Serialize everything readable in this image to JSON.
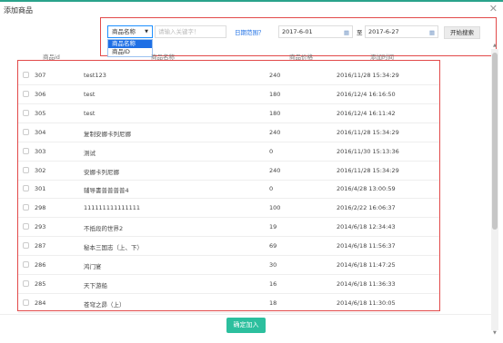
{
  "dialog": {
    "title": "添加商品",
    "confirm_label": "确定加入"
  },
  "search": {
    "type_selected": "商品名称",
    "type_options": [
      "商品名称",
      "商品ID"
    ],
    "keyword_placeholder": "请输入关键字！",
    "date_label": "日期范围？",
    "date_from": "2017-6-01",
    "to_label": "至",
    "date_to": "2017-6-27",
    "search_button": "开始搜索"
  },
  "table": {
    "headers": [
      "商品id",
      "商品名称",
      "商品价格",
      "添加时间"
    ],
    "rows": [
      {
        "id": "307",
        "name": "test123",
        "price": "240",
        "time": "2016/11/28 15:34:29"
      },
      {
        "id": "306",
        "name": "test",
        "price": "180",
        "time": "2016/12/4 16:16:50"
      },
      {
        "id": "305",
        "name": "test",
        "price": "180",
        "time": "2016/12/4 16:11:42"
      },
      {
        "id": "304",
        "name": "复制安娜卡列尼娜",
        "price": "240",
        "time": "2016/11/28 15:34:29"
      },
      {
        "id": "303",
        "name": "测试",
        "price": "0",
        "time": "2016/11/30 15:13:36"
      },
      {
        "id": "302",
        "name": "安娜卡列尼娜",
        "price": "240",
        "time": "2016/11/28 15:34:29"
      },
      {
        "id": "301",
        "name": "辅导書普普普普4",
        "price": "0",
        "time": "2016/4/28 13:00:59"
      },
      {
        "id": "298",
        "name": "111111111111111",
        "price": "100",
        "time": "2016/2/22 16:06:37"
      },
      {
        "id": "293",
        "name": "不抵段的世界2",
        "price": "19",
        "time": "2014/6/18 12:34:43"
      },
      {
        "id": "287",
        "name": "秘本三国志（上、下）",
        "price": "69",
        "time": "2014/6/18 11:56:37"
      },
      {
        "id": "286",
        "name": "鸿门宴",
        "price": "30",
        "time": "2014/6/18 11:47:25"
      },
      {
        "id": "285",
        "name": "天下游船",
        "price": "16",
        "time": "2014/6/18 11:36:33"
      },
      {
        "id": "284",
        "name": "苍穹之昴（上）",
        "price": "18",
        "time": "2014/6/18 11:30:05"
      }
    ]
  },
  "colors": {
    "accent": "#2cbf9e",
    "highlight_box": "#e24a4a",
    "dropdown_selected": "#1e6fe5"
  }
}
